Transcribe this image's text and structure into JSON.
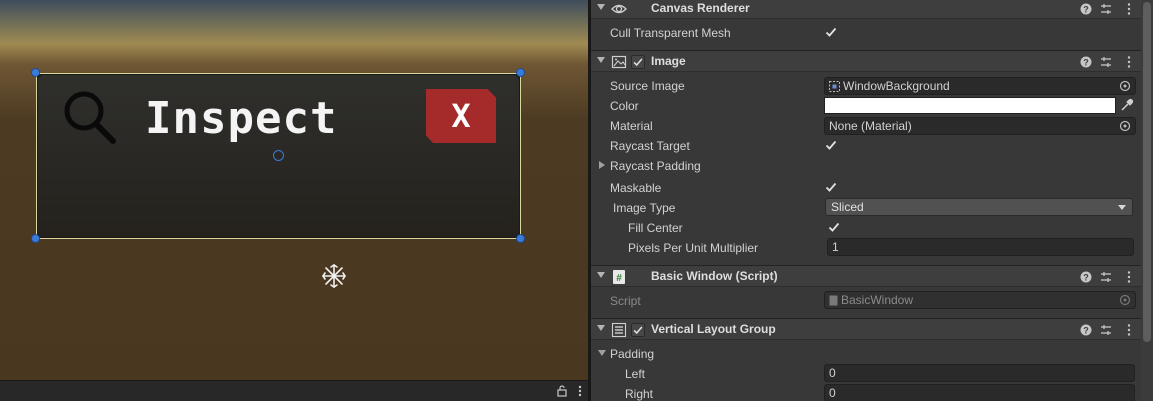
{
  "scene": {
    "title_text": "Inspect",
    "close_label": "X"
  },
  "inspector": {
    "canvas_renderer": {
      "title": "Canvas Renderer",
      "cull_label": "Cull Transparent Mesh",
      "cull_checked": true
    },
    "image": {
      "title": "Image",
      "enabled": true,
      "source_image_label": "Source Image",
      "source_image_value": "WindowBackground",
      "color_label": "Color",
      "color_value": "#ffffff",
      "material_label": "Material",
      "material_value": "None (Material)",
      "raycast_target_label": "Raycast Target",
      "raycast_target_checked": true,
      "raycast_padding_label": "Raycast Padding",
      "maskable_label": "Maskable",
      "maskable_checked": true,
      "image_type_label": "Image Type",
      "image_type_value": "Sliced",
      "fill_center_label": "Fill Center",
      "fill_center_checked": true,
      "ppu_label": "Pixels Per Unit Multiplier",
      "ppu_value": "1"
    },
    "basic_window": {
      "title": "Basic Window (Script)",
      "script_label": "Script",
      "script_value": "BasicWindow"
    },
    "vertical_layout": {
      "title": "Vertical Layout Group",
      "enabled": true,
      "padding_label": "Padding",
      "left_label": "Left",
      "left_value": "0",
      "right_label": "Right",
      "right_value": "0"
    }
  },
  "colors": {
    "accent_blue": "#3b7bd8",
    "close_red": "#a52a2a",
    "inspector_bg": "#383838",
    "header_bg": "#3e3e3e"
  }
}
